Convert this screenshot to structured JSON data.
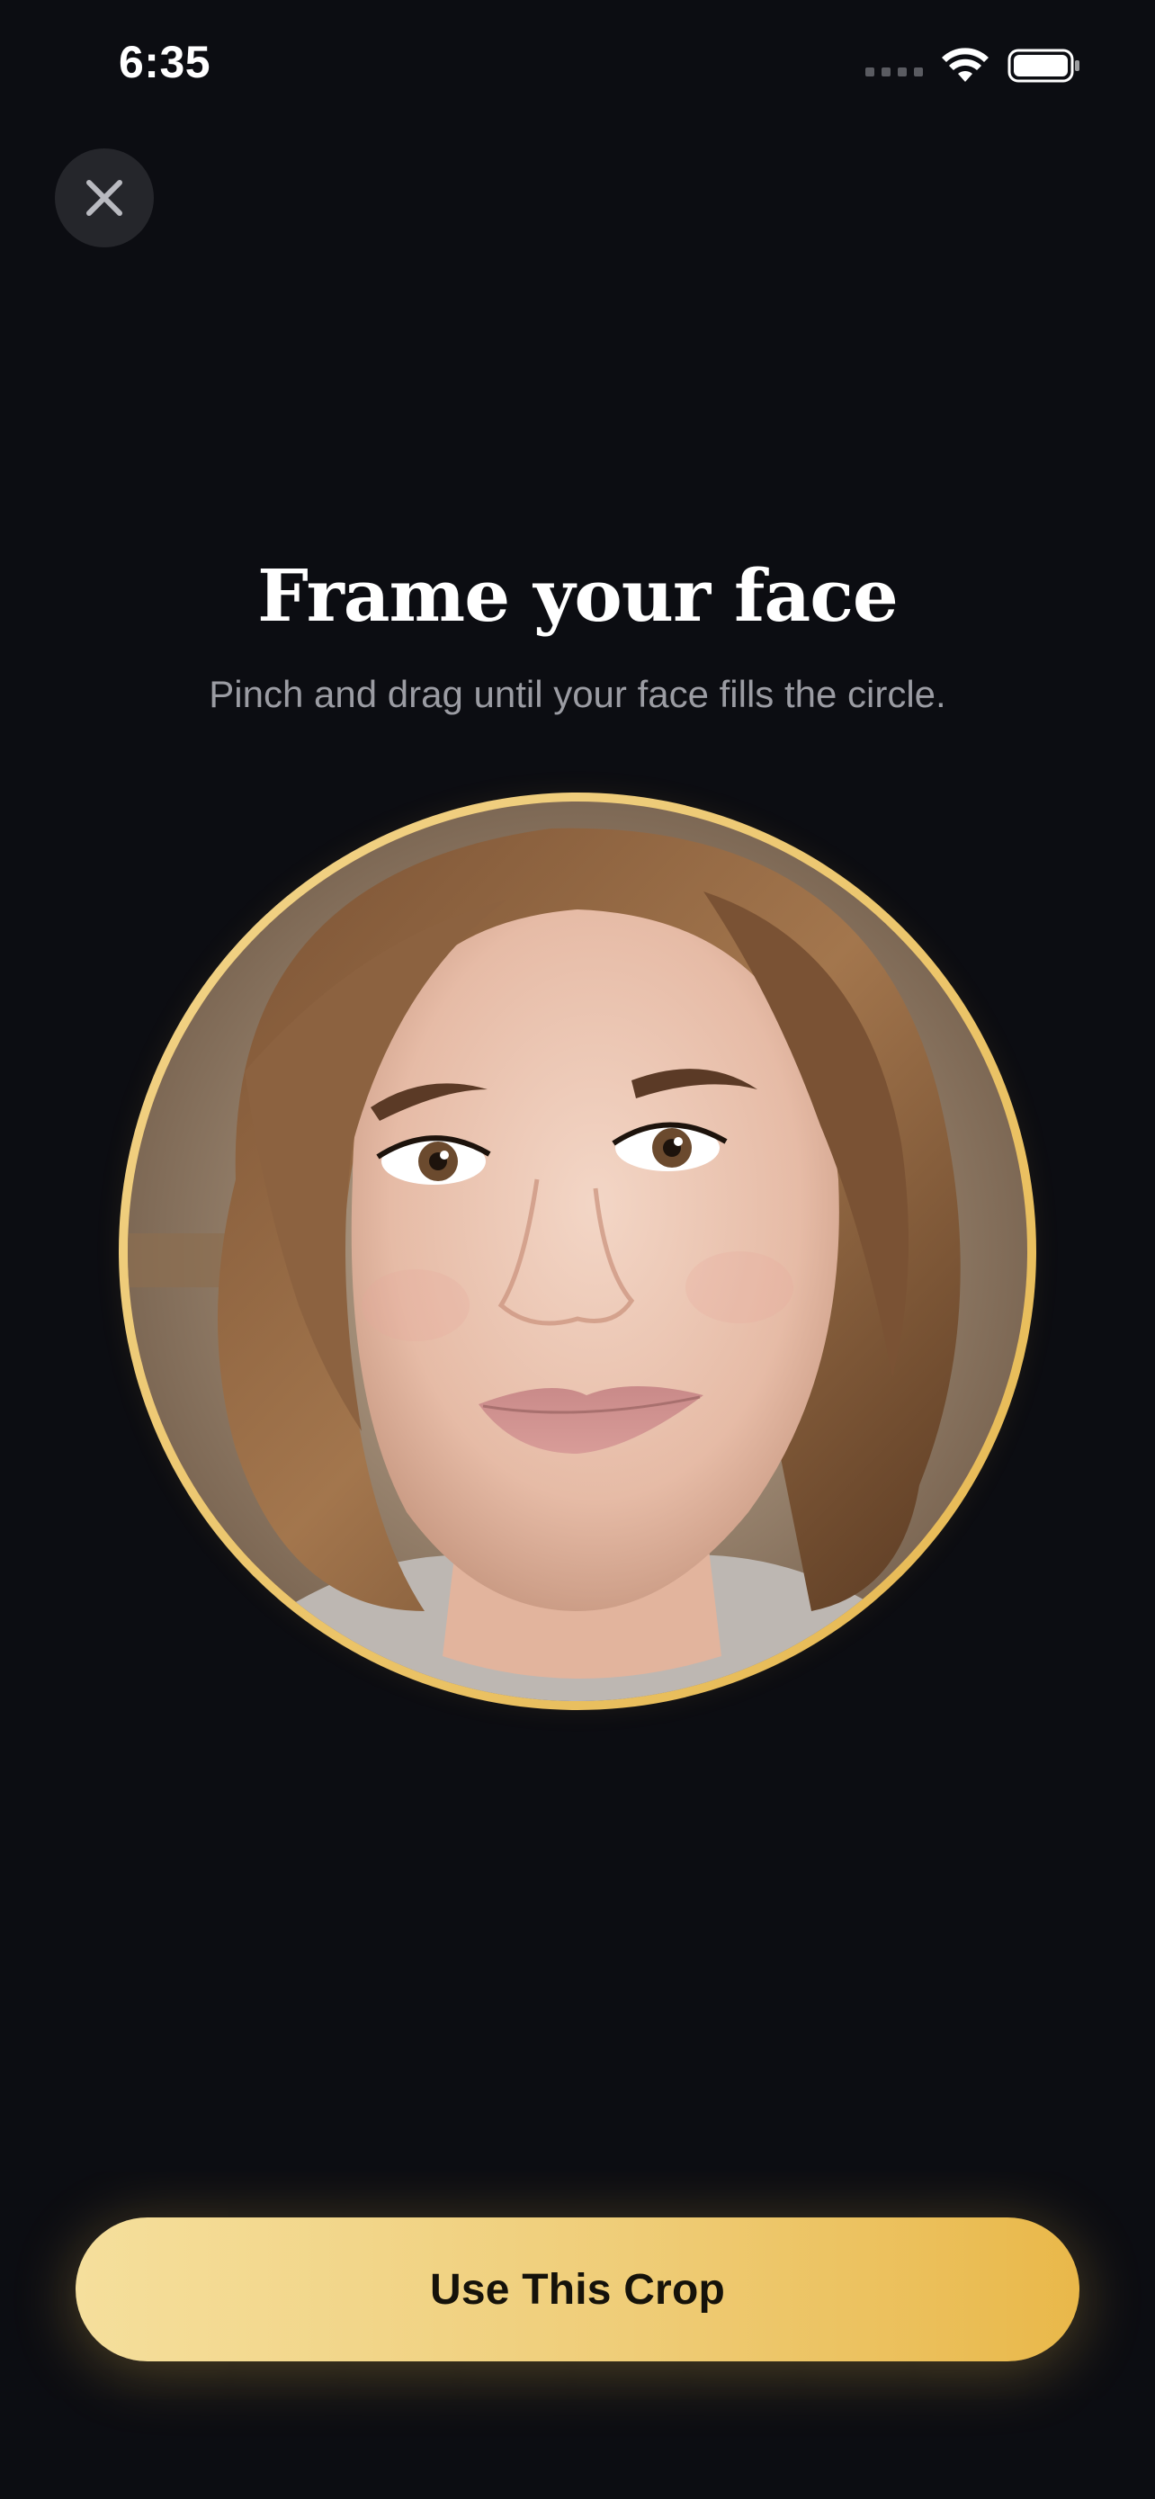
{
  "status_bar": {
    "time": "6:35"
  },
  "header": {
    "close_icon": "close-icon"
  },
  "content": {
    "title": "Frame your face",
    "subtitle": "Pinch and drag until your face fills the circle."
  },
  "cropper": {
    "ring_color": "#E9BE5C"
  },
  "footer": {
    "cta_label": "Use This Crop"
  },
  "colors": {
    "background": "#0C0D12",
    "accent": "#EBC063",
    "subtitle": "#9B9CA3"
  }
}
